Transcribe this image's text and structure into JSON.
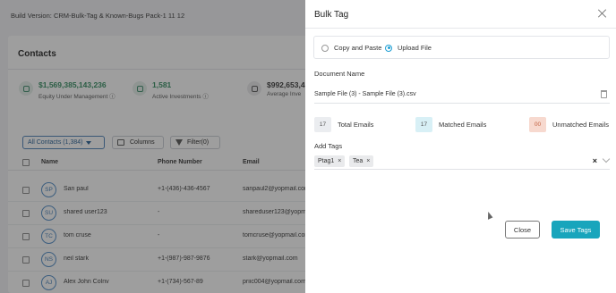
{
  "background": {
    "build_version": "Build Version: CRM-Bulk-Tag & Known-Bugs Pack-1 11 12",
    "contacts_title": "Contacts",
    "stats": [
      {
        "value": "$1,569,385,143,236",
        "label": "Equity Under Management ⓘ"
      },
      {
        "value": "1,581",
        "label": "Active Investments ⓘ"
      },
      {
        "value": "$992,653,4",
        "label": "Average Inve"
      }
    ],
    "filters": {
      "all_contacts": "All Contacts (1,384)",
      "columns": "Columns",
      "filter": "Filter(0)"
    },
    "columns": [
      "Name",
      "Phone Number",
      "Email"
    ],
    "rows": [
      {
        "initials": "SP",
        "name": "San paul",
        "phone": "+1-(436)-436-4567",
        "email": "sanpaul2@yopmail.com"
      },
      {
        "initials": "SU",
        "name": "shared user123",
        "phone": "-",
        "email": "shareduser123@yopmail.com"
      },
      {
        "initials": "TC",
        "name": "tom cruse",
        "phone": "-",
        "email": "tomcruse@yopmail.com"
      },
      {
        "initials": "NS",
        "name": "neil stark",
        "phone": "+1-(987)-987-9876",
        "email": "stark@yopmail.com"
      },
      {
        "initials": "AJ",
        "name": "Alex John Colnv",
        "phone": "+1-(734)-567-89",
        "email": "priic004@yopmail.com"
      }
    ]
  },
  "panel": {
    "title": "Bulk Tag",
    "radio": {
      "copy_paste": "Copy and Paste",
      "upload_file": "Upload File",
      "selected": "upload_file"
    },
    "document_label": "Document Name",
    "document_value": "Sample File (3) - Sample File (3).csv",
    "counts": [
      {
        "value": "17",
        "label": "Total Emails"
      },
      {
        "value": "17",
        "label": "Matched Emails"
      },
      {
        "value": "00",
        "label": "Unmatched Emails"
      }
    ],
    "tags_label": "Add Tags",
    "tags": [
      "Ptag1",
      "Tea"
    ],
    "close_label": "Close",
    "save_label": "Save Tags"
  },
  "colors": {
    "accent": "#18a5bc",
    "radio_selected": "#1f9fd4",
    "stat_green": "#2f8a5d",
    "unmatched": "#f7d9cf"
  }
}
